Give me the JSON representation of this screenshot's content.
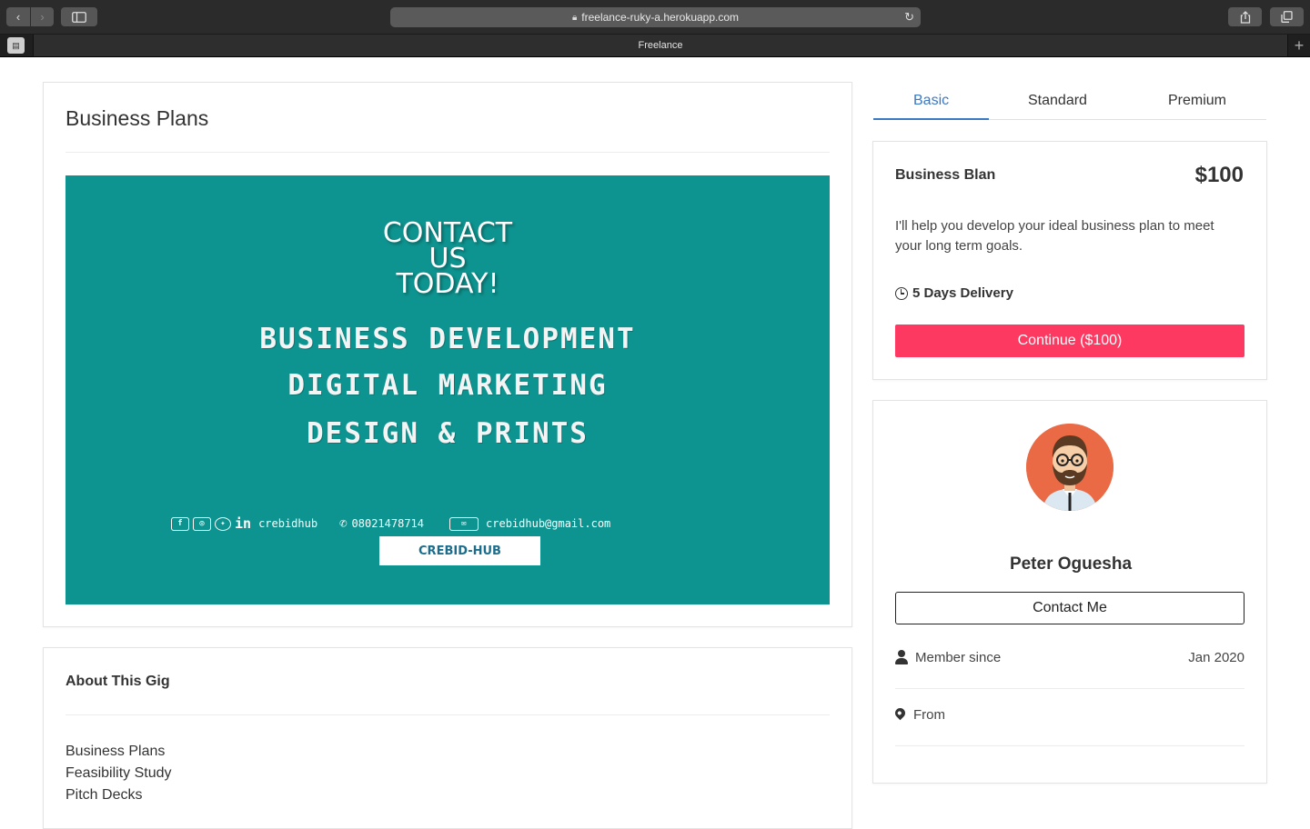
{
  "browser": {
    "url": "freelance-ruky-a.herokuapp.com",
    "tab_title": "Freelance"
  },
  "gig": {
    "title": "Business Plans",
    "banner": {
      "headline": [
        "CONTACT",
        "US",
        "TODAY!"
      ],
      "services": [
        "BUSINESS DEVELOPMENT",
        "DIGITAL MARKETING",
        "DESIGN & PRINTS"
      ],
      "social_handle": "crebidhub",
      "phone": "08021478714",
      "email": "crebidhub@gmail.com",
      "logo_text": "CREBID-HUB"
    }
  },
  "about": {
    "title": "About This Gig",
    "items": [
      "Business Plans",
      "Feasibility Study",
      "Pitch Decks"
    ]
  },
  "packages": {
    "tabs": [
      "Basic",
      "Standard",
      "Premium"
    ],
    "active_tab": "Basic",
    "name": "Business Blan",
    "price": "$100",
    "description": "I'll help you develop your ideal business plan to meet your long term goals.",
    "delivery": "5 Days Delivery",
    "continue_label": "Continue ($100)"
  },
  "seller": {
    "name": "Peter Oguesha",
    "contact_label": "Contact Me",
    "member_since_label": "Member since",
    "member_since_value": "Jan 2020",
    "from_label": "From",
    "from_value": ""
  },
  "colors": {
    "accent_blue": "#3b78c3",
    "cta_pink": "#fe3961",
    "banner_teal": "#0e9490",
    "avatar_orange": "#e96a45"
  }
}
